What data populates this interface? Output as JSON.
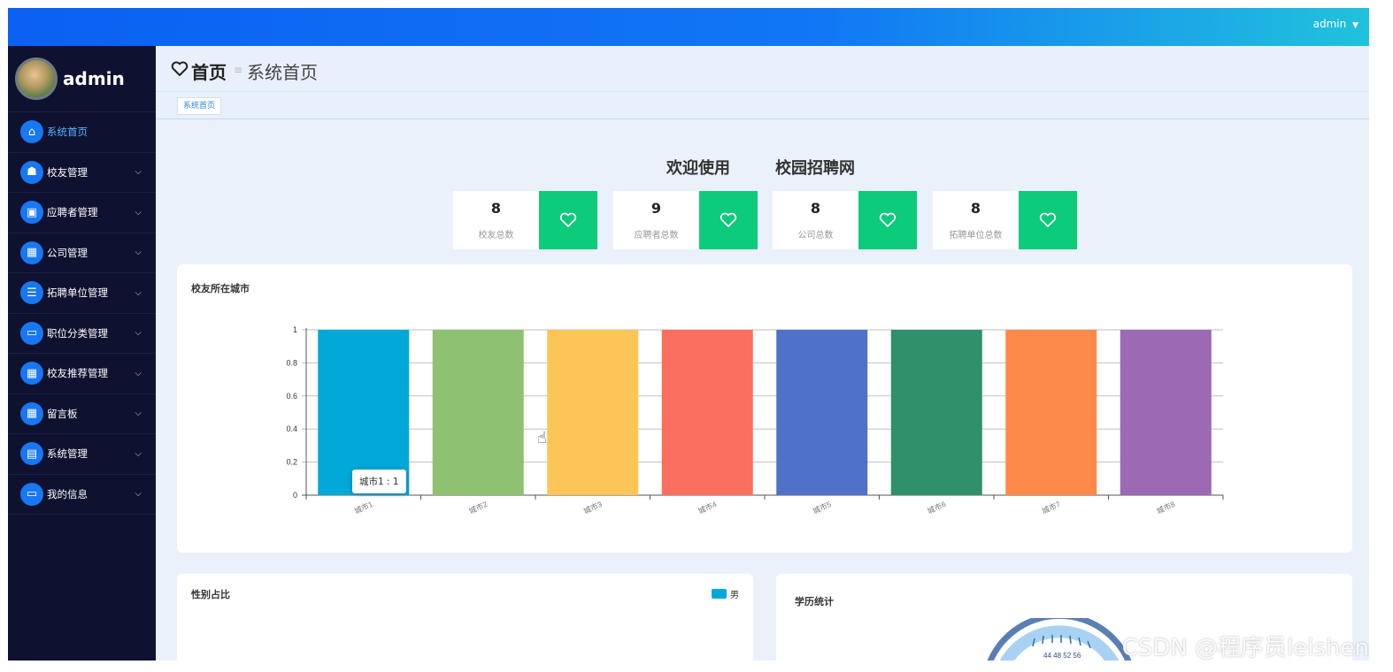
{
  "topbar": {
    "user": "admin",
    "caret": "▼"
  },
  "sidebar": {
    "brand_name": "admin",
    "items": [
      {
        "label": "系统首页",
        "icon": "home-icon",
        "glyph": "⌂",
        "active": true
      },
      {
        "label": "校友管理",
        "icon": "alumni-icon",
        "glyph": "☗"
      },
      {
        "label": "应聘者管理",
        "icon": "briefcase-icon",
        "glyph": "▣"
      },
      {
        "label": "公司管理",
        "icon": "grid-icon",
        "glyph": "▦"
      },
      {
        "label": "拓聘单位管理",
        "icon": "list-icon",
        "glyph": "☰"
      },
      {
        "label": "职位分类管理",
        "icon": "ticket-icon",
        "glyph": "▭"
      },
      {
        "label": "校友推荐管理",
        "icon": "grid-icon",
        "glyph": "▦"
      },
      {
        "label": "留言板",
        "icon": "grid-icon",
        "glyph": "▦"
      },
      {
        "label": "系统管理",
        "icon": "clipboard-icon",
        "glyph": "▤"
      },
      {
        "label": "我的信息",
        "icon": "card-icon",
        "glyph": "▭"
      }
    ]
  },
  "header": {
    "title": "首页",
    "subtitle": "系统首页",
    "separator": "≡"
  },
  "tagbar": {
    "tag": "系统首页"
  },
  "welcome": {
    "line1": "欢迎使用",
    "line2": "校园招聘网"
  },
  "stats": [
    {
      "value": "8",
      "label": "校友总数"
    },
    {
      "value": "9",
      "label": "应聘者总数"
    },
    {
      "value": "8",
      "label": "公司总数"
    },
    {
      "value": "8",
      "label": "拓聘单位总数"
    }
  ],
  "city_card": {
    "title": "校友所在城市"
  },
  "tooltip": {
    "text": "城市1 : 1"
  },
  "gender_card": {
    "title": "性别占比",
    "legend": "男"
  },
  "edu_card": {
    "title": "学历统计",
    "gauge_labels": "44 48 52 56"
  },
  "watermark": "CSDN @程序员leishen",
  "chart_data": {
    "type": "bar",
    "title": "校友所在城市",
    "categories": [
      "城市1",
      "城市2",
      "城市3",
      "城市4",
      "城市5",
      "城市6",
      "城市7",
      "城市8"
    ],
    "values": [
      1,
      1,
      1,
      1,
      1,
      1,
      1,
      1
    ],
    "colors": [
      "#01a8d8",
      "#8fc173",
      "#fdc457",
      "#fa6f5e",
      "#4f71c8",
      "#2f906b",
      "#fd8a4a",
      "#9c69b5"
    ],
    "yticks": [
      "0",
      "0.2",
      "0.4",
      "0.6",
      "0.8",
      "1"
    ],
    "ylim": [
      0,
      1
    ],
    "grid": true
  }
}
